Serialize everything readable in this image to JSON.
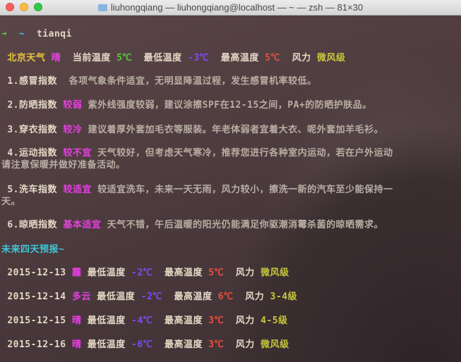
{
  "window": {
    "title": "liuhongqiang — liuhongqiang@localhost — ~ — zsh — 81×30"
  },
  "prompt": {
    "arrow": "➜",
    "dir": "~",
    "command": "tianqi"
  },
  "today": {
    "city": "北京天气",
    "weather": "晴",
    "cur_label": "当前温度",
    "cur": "5℃",
    "low_label": "最低温度",
    "low": "-3℃",
    "high_label": "最高温度",
    "high": "5℃",
    "wind_label": "风力",
    "wind": "微风级"
  },
  "indices": [
    {
      "name": "1.感冒指数",
      "level": "",
      "desc": "各项气象条件适宜，无明显降温过程，发生感冒机率较低。"
    },
    {
      "name": "2.防晒指数",
      "level": "较弱",
      "desc": "紫外线强度较弱，建议涂擦SPF在12-15之间，PA+的防晒护肤品。"
    },
    {
      "name": "3.穿衣指数",
      "level": "较冷",
      "desc": "建议着厚外套加毛衣等服装。年老体弱者宜着大衣、呢外套加羊毛衫。"
    },
    {
      "name": "4.运动指数",
      "level": "较不宜",
      "desc": "天气较好，但考虑天气寒冷，推荐您进行各种室内运动，若在户外运动",
      "desc2": "请注意保暖并做好准备活动。"
    },
    {
      "name": "5.洗车指数",
      "level": "较适宜",
      "desc": "较适宜洗车，未来一天无雨，风力较小，擦洗一新的汽车至少能保持一",
      "desc2": "天。"
    },
    {
      "name": "6.晾晒指数",
      "level": "基本适宜",
      "desc": "天气不错，午后温暖的阳光仍能满足你驱潮消霉杀菌的晾晒需求。"
    }
  ],
  "forecast_title": "未来四天预报~",
  "forecast": [
    {
      "date": "2015-12-13",
      "weather": "霾",
      "low_label": "最低温度",
      "low": "-2℃",
      "high_label": "最高温度",
      "high": "5℃",
      "wind_label": "风力",
      "wind": "微风级"
    },
    {
      "date": "2015-12-14",
      "weather": "多云",
      "low_label": "最低温度",
      "low": "-2℃",
      "high_label": "最高温度",
      "high": "6℃",
      "wind_label": "风力",
      "wind": "3-4级"
    },
    {
      "date": "2015-12-15",
      "weather": "晴",
      "low_label": "最低温度",
      "low": "-4℃",
      "high_label": "最高温度",
      "high": "3℃",
      "wind_label": "风力",
      "wind": "4-5级"
    },
    {
      "date": "2015-12-16",
      "weather": "晴",
      "low_label": "最低温度",
      "low": "-6℃",
      "high_label": "最高温度",
      "high": "3℃",
      "wind_label": "风力",
      "wind": "微风级"
    }
  ]
}
